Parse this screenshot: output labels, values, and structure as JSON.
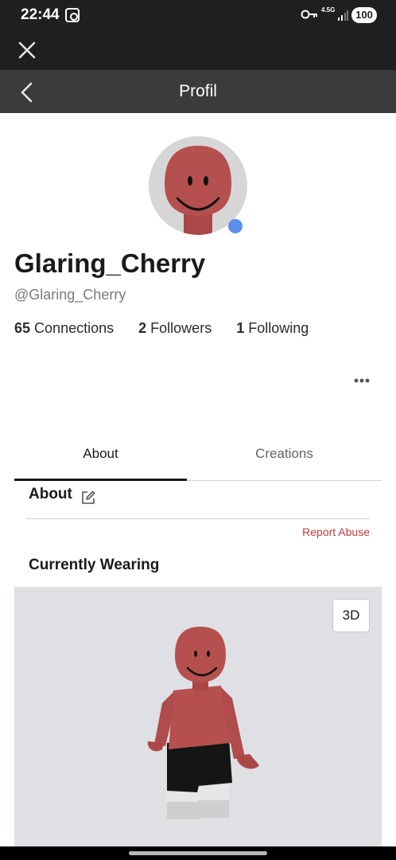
{
  "status_bar": {
    "time": "22:44",
    "network": "4.5G",
    "battery": "100",
    "icons": [
      "screenshot-icon",
      "vpn-key-icon",
      "signal-icon"
    ]
  },
  "header": {
    "title": "Profil"
  },
  "profile": {
    "display_name": "Glaring_Cherry",
    "username": "@Glaring_Cherry",
    "online_color": "#5b8def",
    "stats": [
      {
        "count": "65",
        "label": "Connections"
      },
      {
        "count": "2",
        "label": "Followers"
      },
      {
        "count": "1",
        "label": "Following"
      }
    ]
  },
  "tabs": [
    {
      "label": "About",
      "active": true
    },
    {
      "label": "Creations",
      "active": false
    }
  ],
  "about": {
    "heading": "About",
    "report_label": "Report Abuse"
  },
  "wearing": {
    "heading": "Currently Wearing",
    "view_toggle_label": "3D"
  },
  "colors": {
    "accent_red": "#c33b3b",
    "avatar_skin": "#b5504f",
    "title_bar": "#393b3d"
  }
}
